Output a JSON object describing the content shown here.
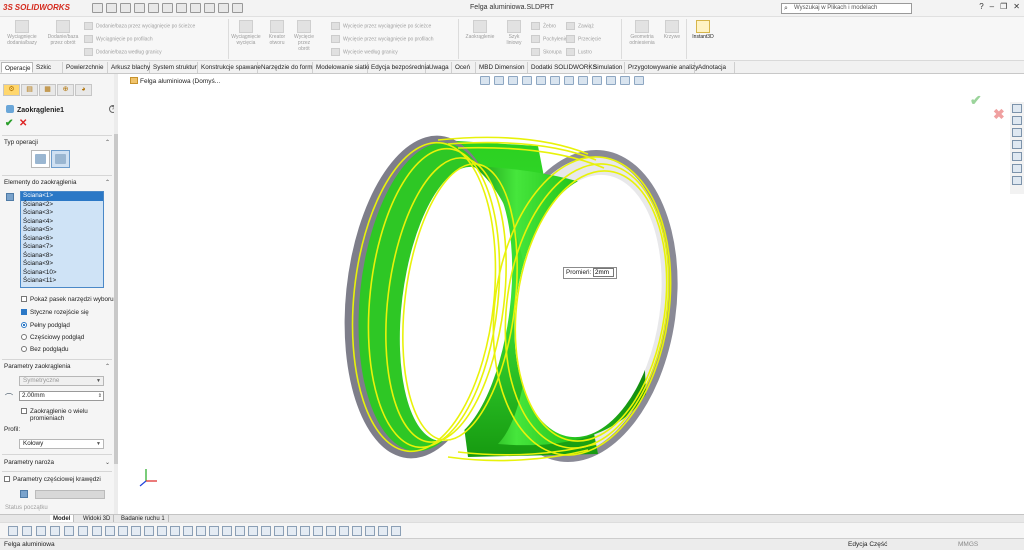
{
  "app": {
    "brand_ds": "3S",
    "brand": "SOLIDWORKS",
    "document_title": "Felga aluminiowa.SLDPRT",
    "search_placeholder": "Wyszukaj w Plikach i modelach"
  },
  "ribbon": {
    "extrude_boss": "Wyciągnięcie dodania/bazy",
    "revolve_boss": "Dodanie/baza przez obrót",
    "sweep_boss": "Dodanie/baza przez wyciągnięcie po ścieżce",
    "loft_boss": "Wyciągnięcie po profilach",
    "boundary_boss": "Dodanie/baza według granicy",
    "extrude_cut": "Wyciągnięcie wycięcia",
    "hole_wizard": "Kreator otworu",
    "revolve_cut": "Wycięcie przez obrót",
    "sweep_cut": "Wycięcie przez wyciągnięcie po ścieżce",
    "loft_cut": "Wycięcie przez wyciągnięcie po profilach",
    "boundary_cut": "Wycięcie według granicy",
    "fillet": "Zaokrąglenie",
    "linear_pattern": "Szyk liniowy",
    "rib": "Żebro",
    "draft": "Pochylenie",
    "shell": "Skorupa",
    "wrap": "Zawiąż",
    "intersect": "Przecięcie",
    "mirror": "Lustro",
    "ref_geometry": "Geometria odniesienia",
    "curves": "Krzywe",
    "instant3d": "Instant3D"
  },
  "tabs": [
    "Operacje",
    "Szkic",
    "Powierzchnie",
    "Arkusz blachy",
    "System struktur",
    "Konstrukcje spawane",
    "Narzędzie do form",
    "Modelowanie siatki",
    "Edycja bezpośrednia",
    "Uwaga",
    "Oceń",
    "MBD Dimension",
    "Dodatki SOLIDWORKS",
    "Simulation",
    "Przygotowywanie analizy",
    "Adnotacja"
  ],
  "property_manager": {
    "title": "Zaokrąglenie1",
    "help": "?",
    "ok": "✔",
    "cancel": "✕",
    "section_type": "Typ operacji",
    "section_items": "Elementy do zaokrąglenia",
    "faces": [
      "Ściana<1>",
      "Ściana<2>",
      "Ściana<3>",
      "Ściana<4>",
      "Ściana<5>",
      "Ściana<6>",
      "Ściana<7>",
      "Ściana<8>",
      "Ściana<9>",
      "Ściana<10>",
      "Ściana<11>"
    ],
    "show_toolbar": "Pokaż pasek narzędzi wyboru",
    "tangent_propagation": "Styczne rozejście się",
    "preview_full": "Pełny podgląd",
    "preview_partial": "Częściowy podgląd",
    "preview_none": "Bez podglądu",
    "section_params": "Parametry zaokrąglenia",
    "symmetric": "Symetryczne",
    "radius": "2.00mm",
    "multi_radius": "Zaokrąglenie o wielu promieniach",
    "profile_label": "Profil:",
    "profile_value": "Kołowy",
    "section_setback": "Parametry naroża",
    "section_partial_edge": "Parametry częściowej krawędzi",
    "status_start": "Status początku"
  },
  "graphics": {
    "tree_item": "Felga aluminiowa (Domyś...",
    "callout_label": "Promień:",
    "callout_value": "2mm",
    "confirm_ok": "✔",
    "confirm_cancel": "✖",
    "colors": {
      "face": "#22c41c",
      "edge_highlight": "#e8f20a",
      "rim": "#8a8a96"
    }
  },
  "bottom": {
    "tabs": [
      "Model",
      "Widoki 3D",
      "Badanie ruchu 1"
    ],
    "status_left": "Felga aluminiowa",
    "status_mid": "Edycja Część",
    "status_right": "MMGS"
  }
}
